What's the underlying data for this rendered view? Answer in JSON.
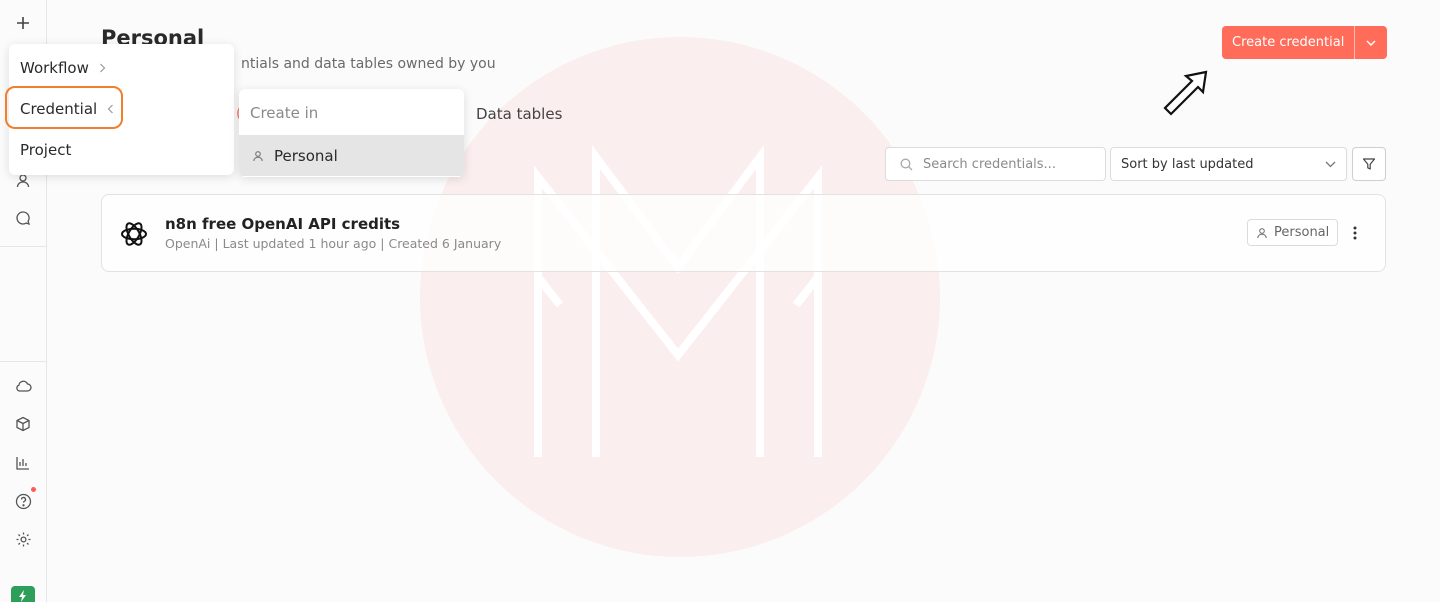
{
  "page": {
    "title": "Personal",
    "subtitle_visible": "ntials and data tables owned by you"
  },
  "tabs": {
    "active_fragment": "(",
    "data_tables": "Data tables"
  },
  "header": {
    "create_button_label": "Create credential",
    "accent_color": "#ff6d5a"
  },
  "toolbar": {
    "search_placeholder": "Search credentials...",
    "sort_selected": "Sort by last updated"
  },
  "credentials": [
    {
      "name": "n8n free OpenAI API credits",
      "meta": "OpenAi | Last updated 1 hour ago | Created 6 January",
      "project_badge": "Personal",
      "icon": "openai-icon"
    }
  ],
  "add_menu": {
    "items": [
      {
        "label": "Workflow",
        "submenu_icon": "chevron-right-icon"
      },
      {
        "label": "Credential",
        "submenu_icon": "chevron-left-icon",
        "highlighted": true
      },
      {
        "label": "Project"
      }
    ]
  },
  "create_in_menu": {
    "header": "Create in",
    "items": [
      {
        "label": "Personal",
        "icon": "user-icon"
      }
    ]
  },
  "sidebar": {
    "icons": [
      "plus-icon",
      "user-icon",
      "chat-icon",
      "cloud-icon",
      "package-icon",
      "chart-icon",
      "help-icon",
      "gear-icon",
      "bolt-icon"
    ]
  }
}
